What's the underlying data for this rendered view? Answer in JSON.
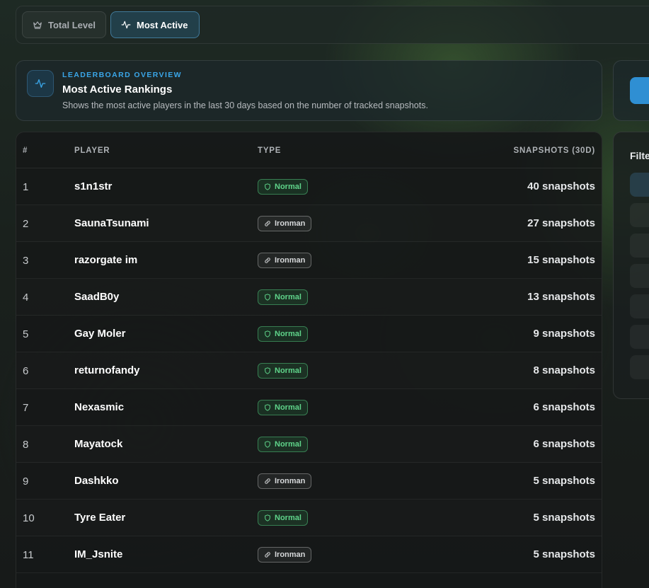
{
  "tabs": [
    {
      "label": "Total Level",
      "icon": "crown-icon",
      "active": false
    },
    {
      "label": "Most Active",
      "icon": "activity-icon",
      "active": true
    }
  ],
  "overview": {
    "icon": "activity-icon",
    "kicker": "LEADERBOARD OVERVIEW",
    "title": "Most Active Rankings",
    "description": "Shows the most active players in the last 30 days based on the number of tracked snapshots."
  },
  "side": {
    "filter_label": "Filte"
  },
  "table": {
    "headers": {
      "rank": "#",
      "player": "PLAYER",
      "type": "TYPE",
      "snapshots": "SNAPSHOTS (30D)"
    },
    "rows": [
      {
        "rank": "1",
        "player": "s1n1str",
        "type": "Normal",
        "snapshots": "40 snapshots"
      },
      {
        "rank": "2",
        "player": "SaunaTsunami",
        "type": "Ironman",
        "snapshots": "27 snapshots"
      },
      {
        "rank": "3",
        "player": "razorgate im",
        "type": "Ironman",
        "snapshots": "15 snapshots"
      },
      {
        "rank": "4",
        "player": "SaadB0y",
        "type": "Normal",
        "snapshots": "13 snapshots"
      },
      {
        "rank": "5",
        "player": "Gay Moler",
        "type": "Normal",
        "snapshots": "9 snapshots"
      },
      {
        "rank": "6",
        "player": "returnofandy",
        "type": "Normal",
        "snapshots": "8 snapshots"
      },
      {
        "rank": "7",
        "player": "Nexasmic",
        "type": "Normal",
        "snapshots": "6 snapshots"
      },
      {
        "rank": "8",
        "player": "Mayatock",
        "type": "Normal",
        "snapshots": "6 snapshots"
      },
      {
        "rank": "9",
        "player": "Dashkko",
        "type": "Ironman",
        "snapshots": "5 snapshots"
      },
      {
        "rank": "10",
        "player": "Tyre Eater",
        "type": "Normal",
        "snapshots": "5 snapshots"
      },
      {
        "rank": "11",
        "player": "IM_Jsnite",
        "type": "Ironman",
        "snapshots": "5 snapshots"
      }
    ]
  },
  "colors": {
    "accent": "#3aa6e8",
    "normal_badge": "#5fd48a",
    "ironman_badge": "#d6d8da"
  }
}
